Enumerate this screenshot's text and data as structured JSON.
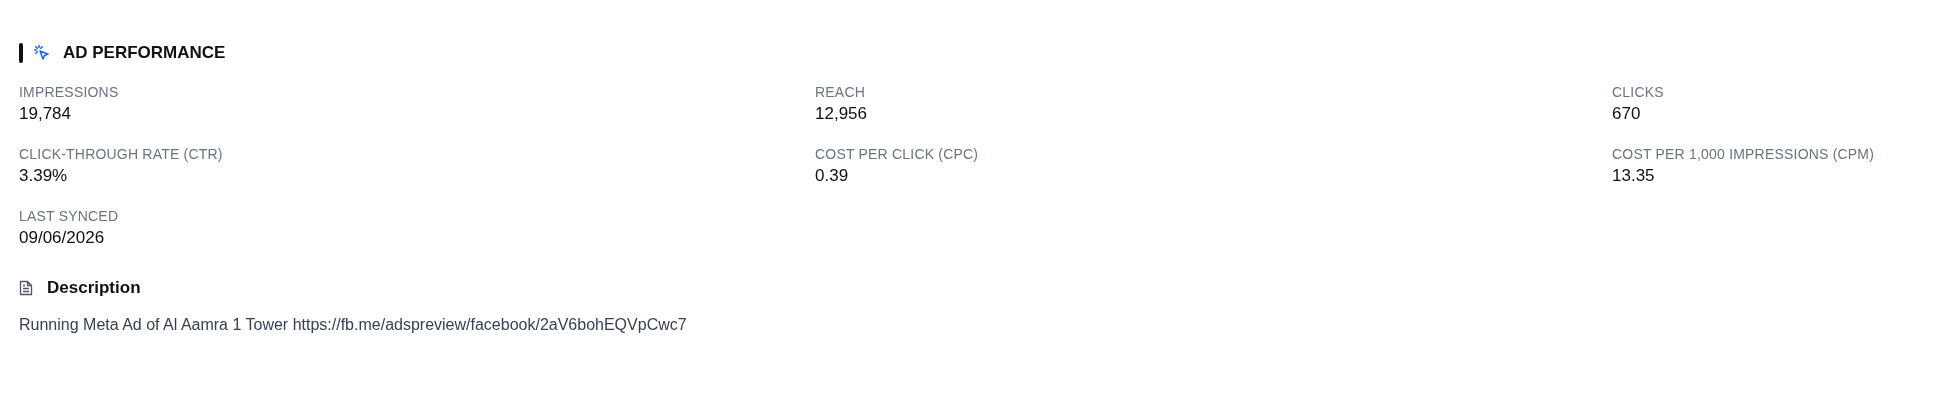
{
  "section": {
    "title": "AD PERFORMANCE"
  },
  "metrics": [
    {
      "label": "IMPRESSIONS",
      "value": "19,784"
    },
    {
      "label": "REACH",
      "value": "12,956"
    },
    {
      "label": "CLICKS",
      "value": "670"
    },
    {
      "label": "CLICK-THROUGH RATE (CTR)",
      "value": "3.39%"
    },
    {
      "label": "COST PER CLICK (CPC)",
      "value": "0.39"
    },
    {
      "label": "COST PER 1,000 IMPRESSIONS (CPM)",
      "value": "13.35"
    },
    {
      "label": "LAST SYNCED",
      "value": "09/06/2026"
    }
  ],
  "description": {
    "title": "Description",
    "text": "Running Meta Ad of Al Aamra 1 Tower https://fb.me/adspreview/facebook/2aV6bohEQVpCwc7"
  }
}
